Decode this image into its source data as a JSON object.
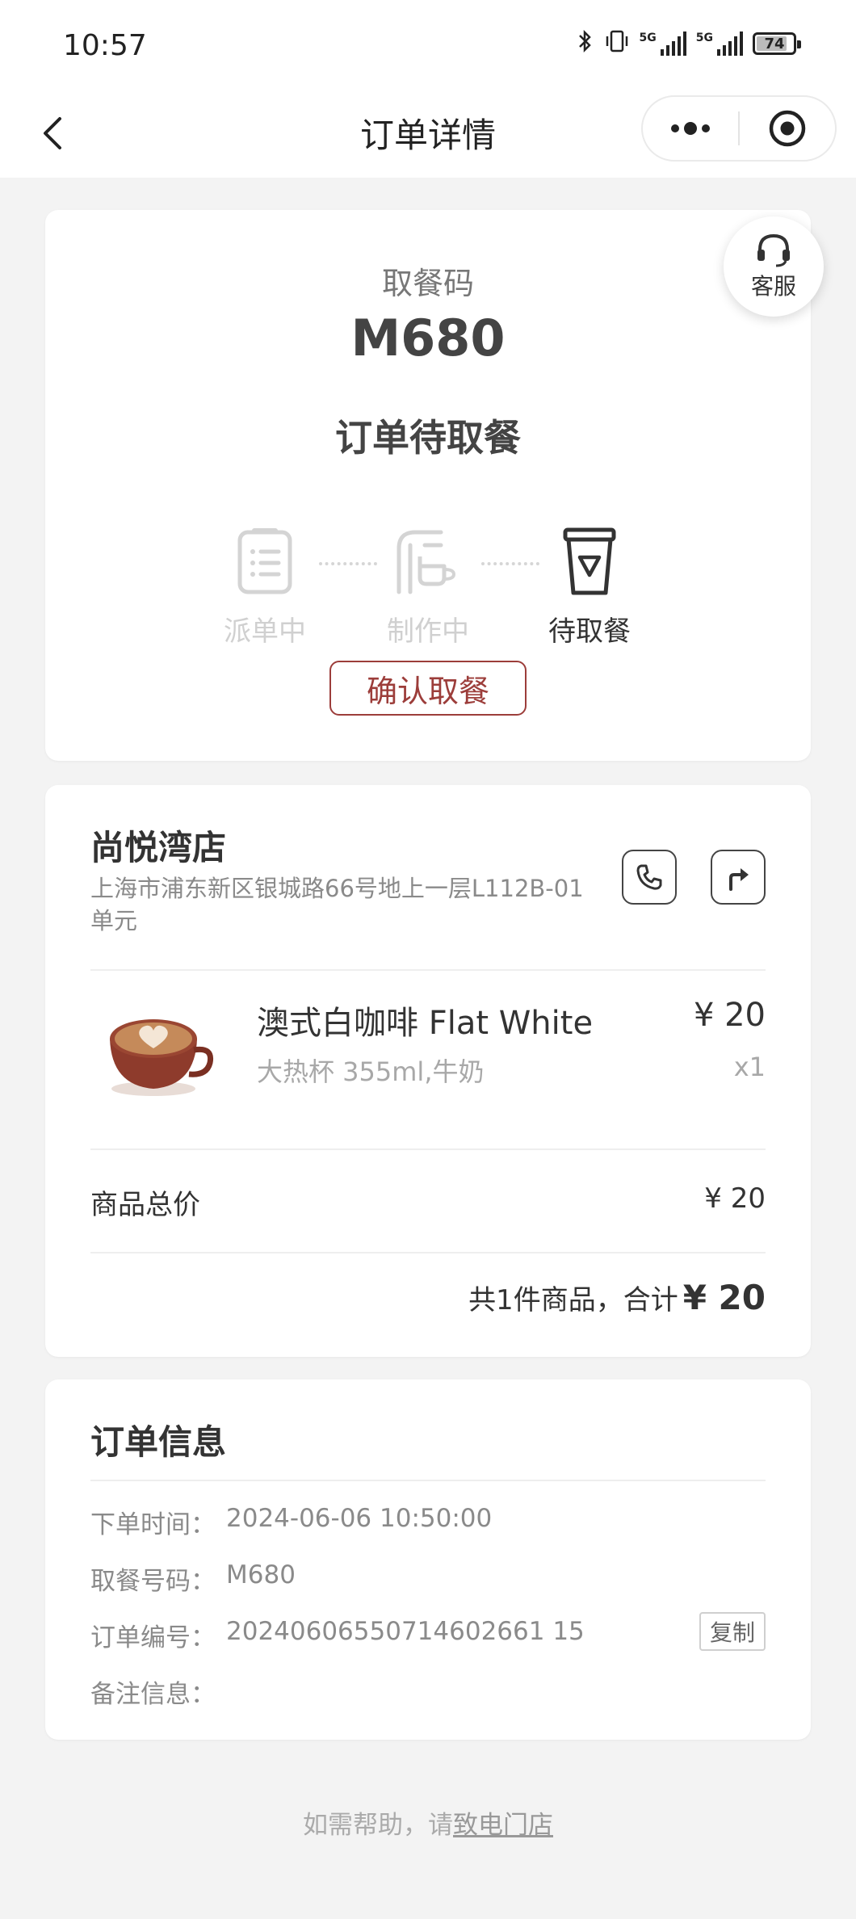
{
  "status_bar": {
    "time": "10:57",
    "net1": "5G",
    "net2": "5G",
    "battery_level": "74"
  },
  "nav": {
    "title": "订单详情"
  },
  "customer_service": {
    "label": "客服"
  },
  "pickup": {
    "label": "取餐码",
    "code": "M680",
    "status": "订单待取餐",
    "steps": [
      {
        "label": "派单中",
        "state": "done"
      },
      {
        "label": "制作中",
        "state": "done"
      },
      {
        "label": "待取餐",
        "state": "current"
      }
    ],
    "confirm_label": "确认取餐"
  },
  "store": {
    "name": "尚悦湾店",
    "address": "上海市浦东新区银城路66号地上一层L112B-01单元"
  },
  "product": {
    "name": "澳式白咖啡 Flat White",
    "spec": "大热杯 355ml,牛奶",
    "price": "¥ 20",
    "qty": "x1"
  },
  "summary": {
    "subtotal_label": "商品总价",
    "subtotal_value": "¥ 20",
    "total_prefix": "共1件商品，合计",
    "total_amount": "¥ 20"
  },
  "order_info": {
    "title": "订单信息",
    "rows": [
      {
        "key": "下单时间：",
        "value": "2024-06-06 10:50:00"
      },
      {
        "key": "取餐号码：",
        "value": "M680"
      },
      {
        "key": "订单编号：",
        "value": "20240606550714602661 15"
      },
      {
        "key": "备注信息：",
        "value": ""
      }
    ],
    "copy_label": "复制"
  },
  "help": {
    "prefix": "如需帮助，请",
    "link": "致电门店"
  },
  "colors": {
    "accent": "#9c3d3a",
    "bg": "#f3f3f3"
  }
}
